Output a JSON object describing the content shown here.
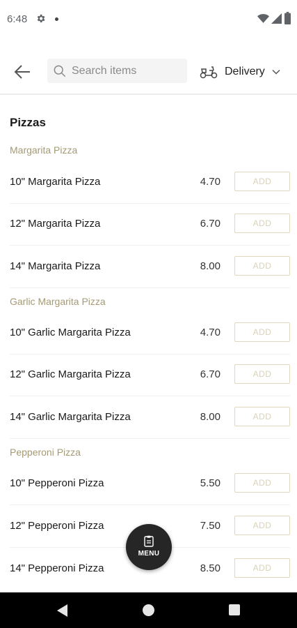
{
  "status_bar": {
    "time": "6:48",
    "icons": [
      "gear-icon",
      "notification-dot-icon",
      "wifi-icon",
      "signal-icon",
      "battery-icon"
    ]
  },
  "header": {
    "back_icon": "arrow-left-icon",
    "search": {
      "placeholder": "Search items",
      "value": ""
    },
    "delivery": {
      "label": "Delivery",
      "icon": "scooter-icon",
      "chevron": "chevron-down-icon"
    }
  },
  "colors": {
    "group_title": "#a59a74",
    "add_border": "#e0d8bc",
    "add_text": "#d8d2b8",
    "fab_bg": "#262626",
    "nav_bar": "#000000"
  },
  "menu": {
    "section_title": "Pizzas",
    "groups": [
      {
        "title": "Margarita Pizza",
        "items": [
          {
            "name": "10\" Margarita Pizza",
            "price": "4.70",
            "action": "ADD"
          },
          {
            "name": "12\" Margarita Pizza",
            "price": "6.70",
            "action": "ADD"
          },
          {
            "name": "14\" Margarita Pizza",
            "price": "8.00",
            "action": "ADD"
          }
        ]
      },
      {
        "title": "Garlic Margarita Pizza",
        "items": [
          {
            "name": "10\" Garlic Margarita Pizza",
            "price": "4.70",
            "action": "ADD"
          },
          {
            "name": "12\" Garlic Margarita Pizza",
            "price": "6.70",
            "action": "ADD"
          },
          {
            "name": "14\" Garlic Margarita Pizza",
            "price": "8.00",
            "action": "ADD"
          }
        ]
      },
      {
        "title": "Pepperoni Pizza",
        "items": [
          {
            "name": "10\" Pepperoni Pizza",
            "price": "5.50",
            "action": "ADD"
          },
          {
            "name": "12\" Pepperoni Pizza",
            "price": "7.50",
            "action": "ADD"
          },
          {
            "name": "14\" Pepperoni Pizza",
            "price": "8.50",
            "action": "ADD"
          }
        ]
      }
    ]
  },
  "fab": {
    "label": "MENU",
    "icon": "clipboard-icon"
  },
  "nav_bar": {
    "icons": [
      "back-triangle-icon",
      "home-circle-icon",
      "recents-square-icon"
    ]
  }
}
